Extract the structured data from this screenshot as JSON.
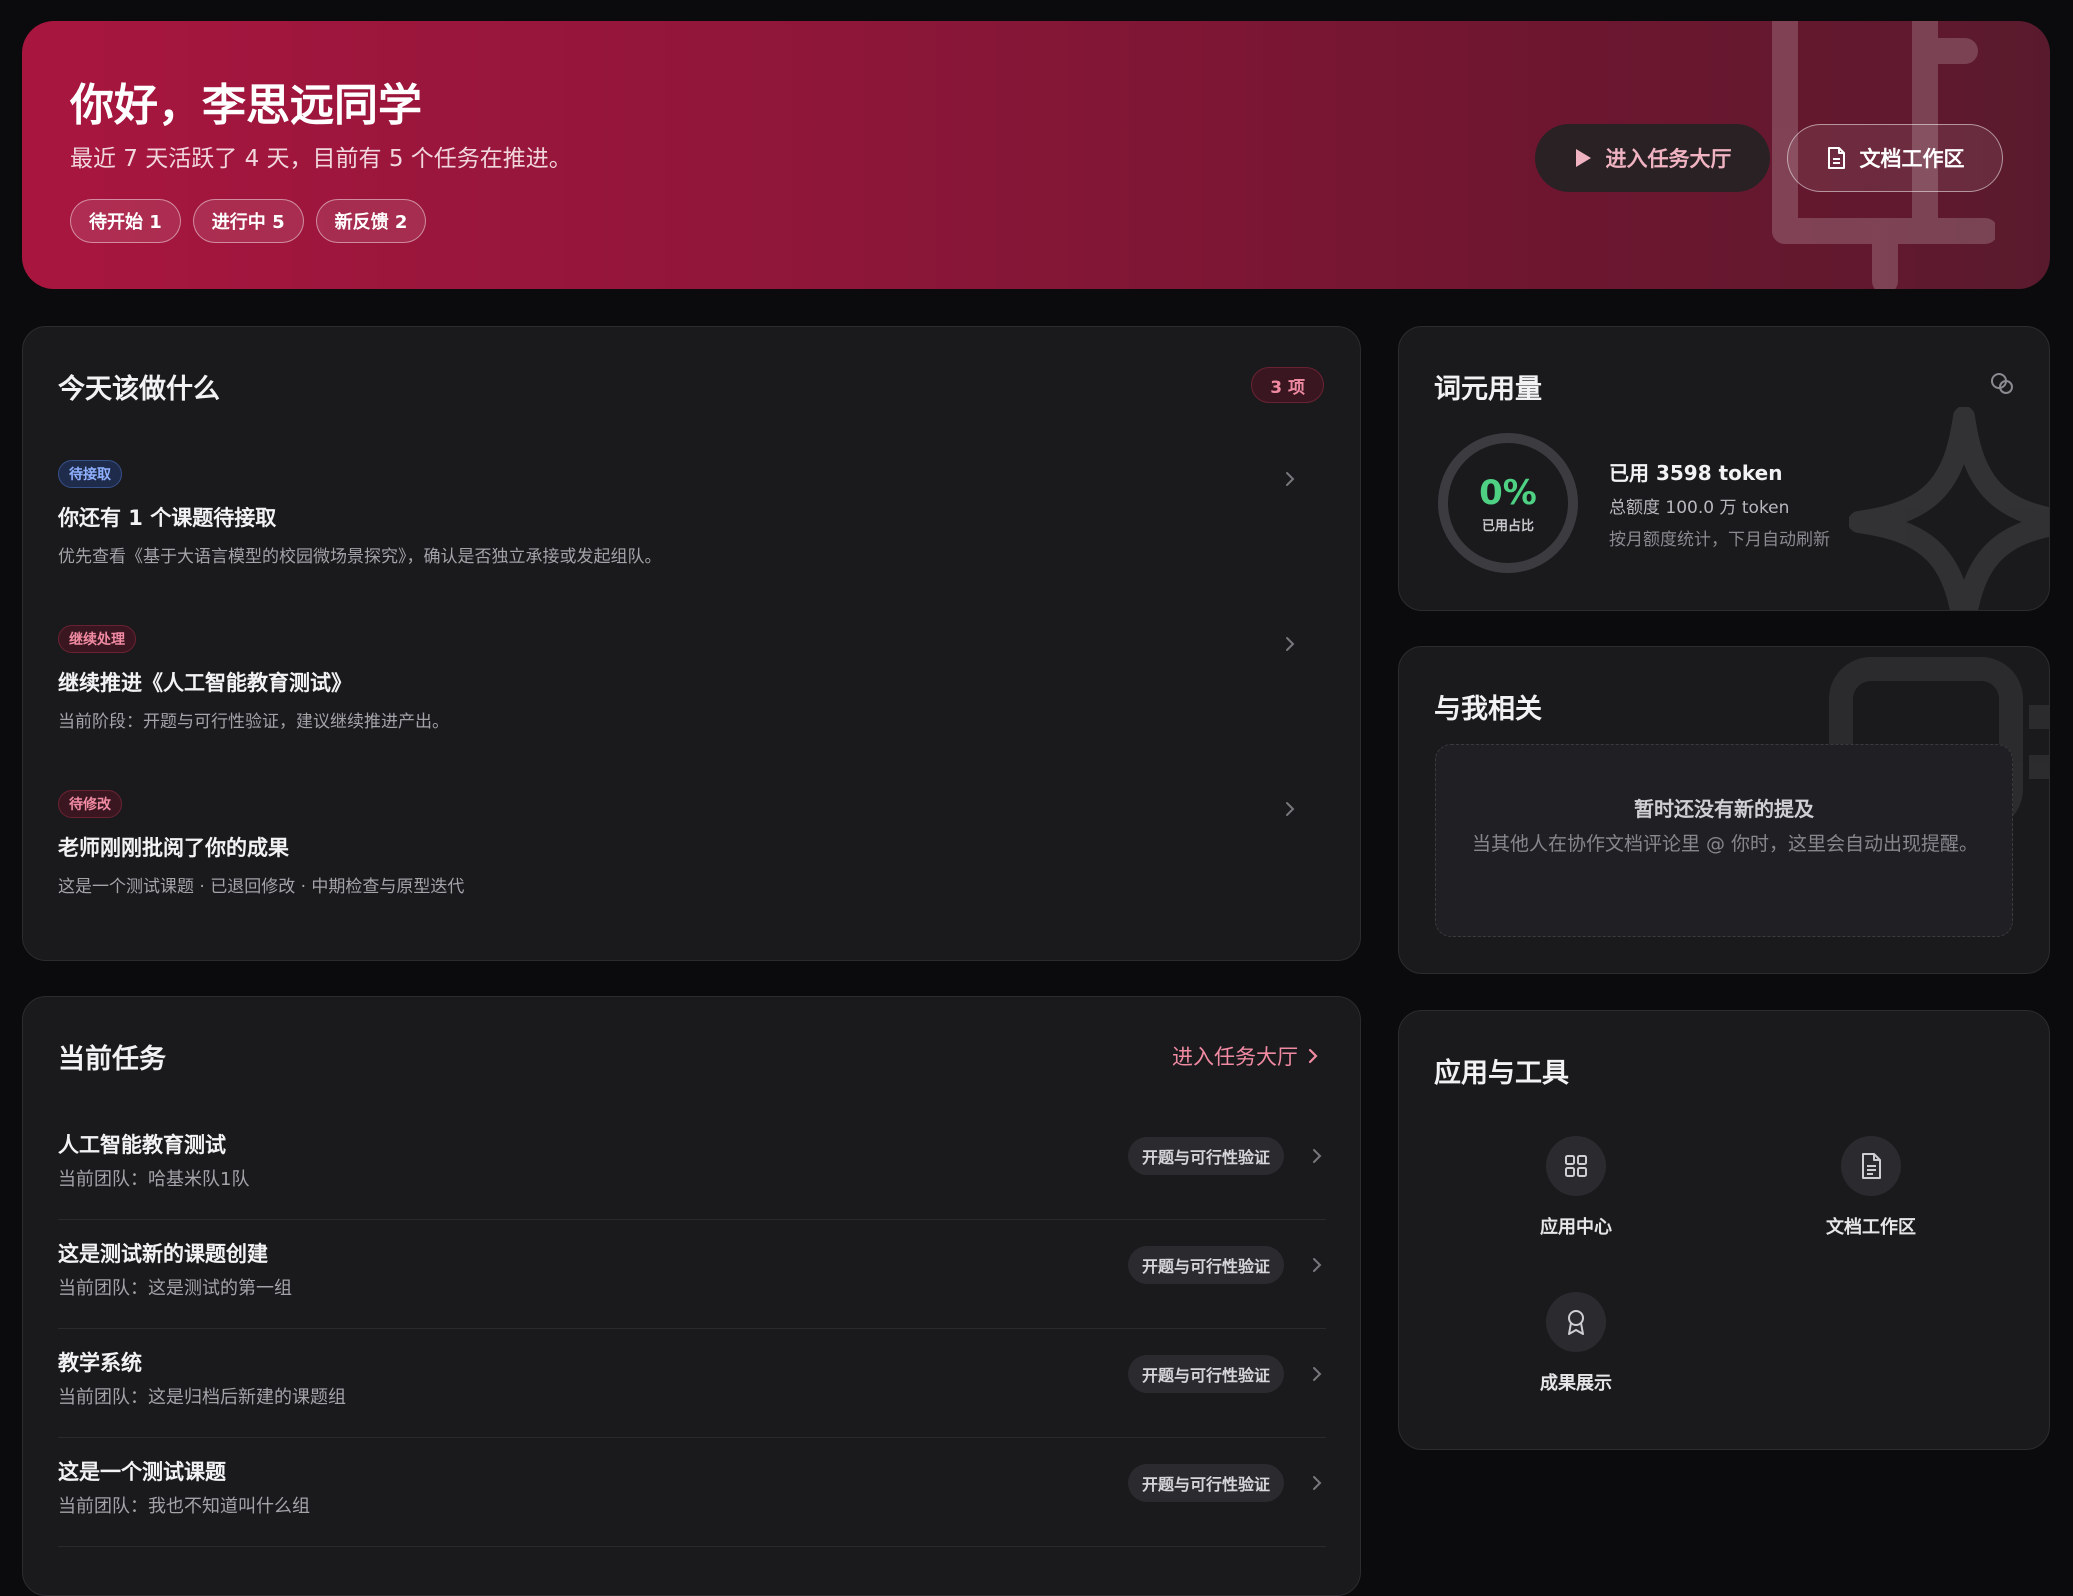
{
  "hero": {
    "greeting": "你好，李思远同学",
    "summary": "最近 7 天活跃了 4 天，目前有 5 个任务在推进。",
    "chips": [
      "待开始 1",
      "进行中 5",
      "新反馈 2"
    ],
    "btn_hall": "进入任务大厅",
    "btn_doc": "文档工作区",
    "accent": "#a8163f"
  },
  "today": {
    "title": "今天该做什么",
    "count": "3 项",
    "items": [
      {
        "tag": "待接取",
        "title": "你还有 1 个课题待接取",
        "desc": "优先查看《基于大语言模型的校园微场景探究》，确认是否独立承接或发起组队。"
      },
      {
        "tag": "继续处理",
        "title": "继续推进《人工智能教育测试》",
        "desc": "当前阶段：开题与可行性验证，建议继续推进产出。"
      },
      {
        "tag": "待修改",
        "title": "老师刚刚批阅了你的成果",
        "desc": "这是一个测试课题 · 已退回修改 · 中期检查与原型迭代"
      }
    ]
  },
  "tasks": {
    "title": "当前任务",
    "link": "进入任务大厅",
    "rows": [
      {
        "name": "人工智能教育测试",
        "team": "当前团队：哈基米队1队",
        "phase": "开题与可行性验证"
      },
      {
        "name": "这是测试新的课题创建",
        "team": "当前团队：这是测试的第一组",
        "phase": "开题与可行性验证"
      },
      {
        "name": "教学系统",
        "team": "当前团队：这是归档后新建的课题组",
        "phase": "开题与可行性验证"
      },
      {
        "name": "这是一个测试课题",
        "team": "当前团队：我也不知道叫什么组",
        "phase": "开题与可行性验证"
      }
    ]
  },
  "token": {
    "title": "词元用量",
    "percent": "0%",
    "percent_value": 0,
    "percent_label": "已用占比",
    "used": "已用 3598 token",
    "total": "总额度 100.0 万 token",
    "note": "按月额度统计，下月自动刷新",
    "ring_color": "#4ed183"
  },
  "related": {
    "title": "与我相关",
    "empty_title": "暂时还没有新的提及",
    "empty_desc": "当其他人在协作文档评论里 @ 你时，这里会自动出现提醒。"
  },
  "tools": {
    "title": "应用与工具",
    "items": [
      {
        "label": "应用中心",
        "icon": "grid-icon"
      },
      {
        "label": "文档工作区",
        "icon": "document-icon"
      },
      {
        "label": "成果展示",
        "icon": "award-icon"
      }
    ]
  }
}
